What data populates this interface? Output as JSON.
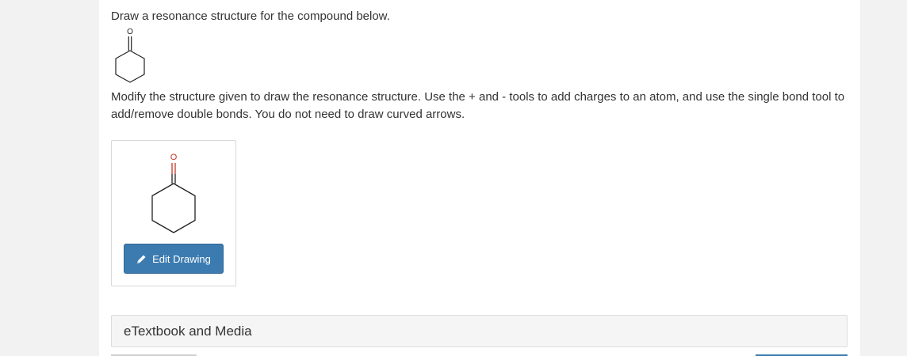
{
  "question": {
    "prompt": "Draw a resonance structure for the compound below.",
    "given_molecule": {
      "atom_label": "O",
      "name": "cyclohexanone"
    },
    "instructions": "Modify the structure given to draw the resonance structure. Use the + and - tools to add charges to an atom, and use the single bond tool to add/remove double bonds. You do not need to draw curved arrows."
  },
  "drawing": {
    "atom_label": "O",
    "oxygen_color": "#c0392b",
    "edit_button_label": "Edit Drawing",
    "edit_icon": "pencil-icon"
  },
  "etextbook": {
    "label": "eTextbook and Media"
  },
  "colors": {
    "button_bg": "#3c7bb0",
    "page_bg": "#ffffff",
    "outer_bg": "#f2f2f2"
  }
}
